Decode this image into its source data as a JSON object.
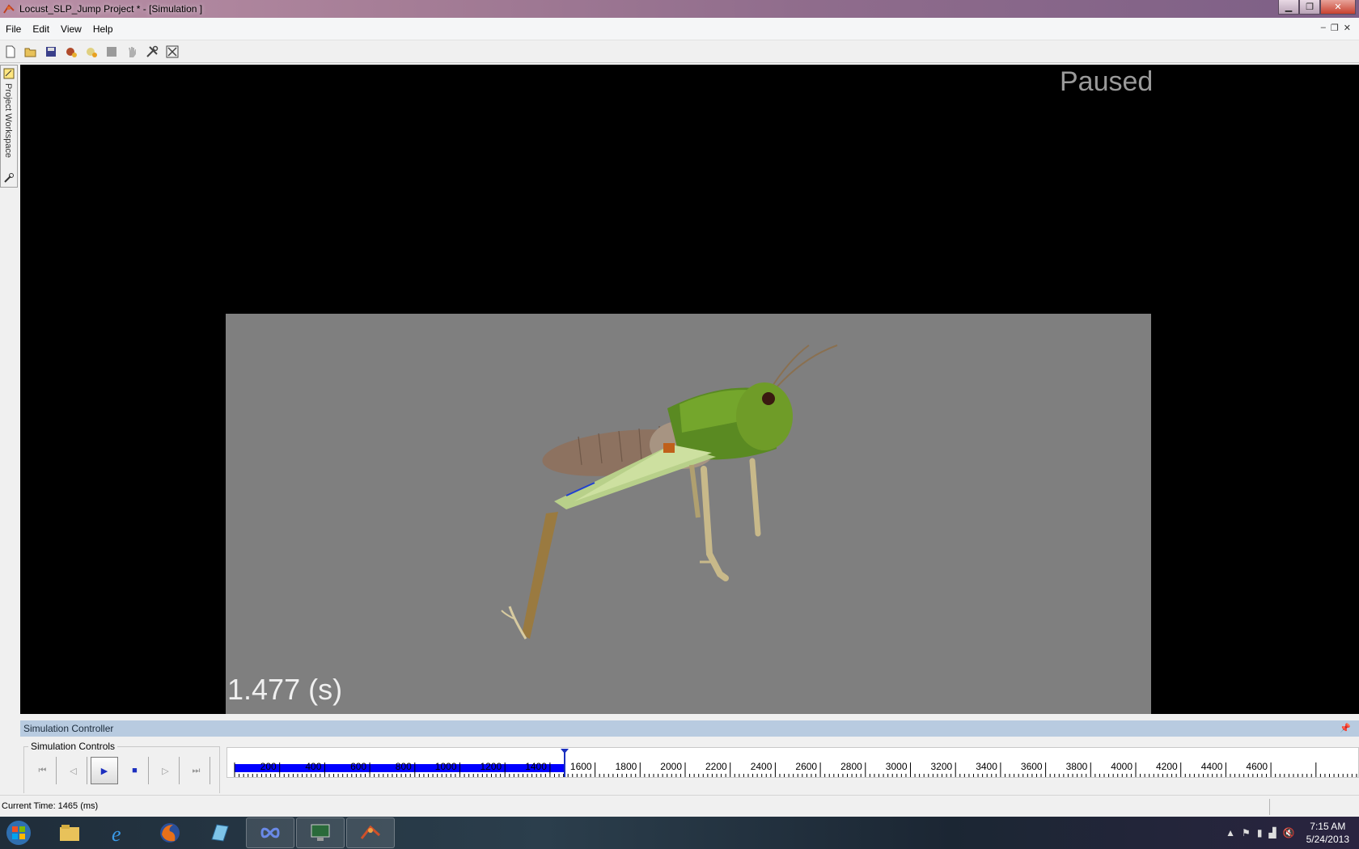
{
  "window": {
    "title": "Locust_SLP_Jump Project * - [Simulation ]",
    "minimize_glyph": "▁",
    "restore_glyph": "❐",
    "close_glyph": "✕"
  },
  "menu": {
    "items": [
      "File",
      "Edit",
      "View",
      "Help"
    ],
    "mdi_minimize": "–",
    "mdi_restore": "❐",
    "mdi_close": "✕"
  },
  "toolbar": {
    "icons": [
      "new-icon",
      "open-icon",
      "save-icon",
      "add-organism-icon",
      "add-structure-icon",
      "stop-sim-icon",
      "hand-icon",
      "tools-icon",
      "close-window-icon"
    ]
  },
  "workspace_tab": {
    "label": "Project Workspace"
  },
  "viewport": {
    "status": "Paused",
    "time_readout": "1.477 (s)",
    "background_color": "#000000",
    "ground_color": "#7f7f7f"
  },
  "sim_controller": {
    "header": "Simulation Controller",
    "pin_glyph": "📌",
    "controls_label": "Simulation Controls",
    "buttons": {
      "to_start": "⏮",
      "step_back": "◁",
      "play": "▶",
      "stop": "■",
      "step_forward": "▷",
      "to_end": "⏭"
    },
    "timeline": {
      "tick_labels": [
        "200",
        "400",
        "600",
        "800",
        "1000",
        "1200",
        "1400",
        "1600",
        "1800",
        "2000",
        "2200",
        "2400",
        "2600",
        "2800",
        "3000",
        "3200",
        "3400",
        "3600",
        "3800",
        "4000",
        "4200",
        "4400",
        "4600"
      ],
      "progress_ms": 1465,
      "progress_color": "#0000ff"
    }
  },
  "status_bar": {
    "current_time": "Current Time: 1465 (ms)"
  },
  "taskbar": {
    "apps": [
      "windows-explorer-icon",
      "internet-explorer-icon",
      "firefox-icon",
      "app-icon",
      "infinity-app-icon",
      "monitor-app-icon",
      "animatlab-icon"
    ],
    "clock_time": "7:15 AM",
    "clock_date": "5/24/2013"
  }
}
